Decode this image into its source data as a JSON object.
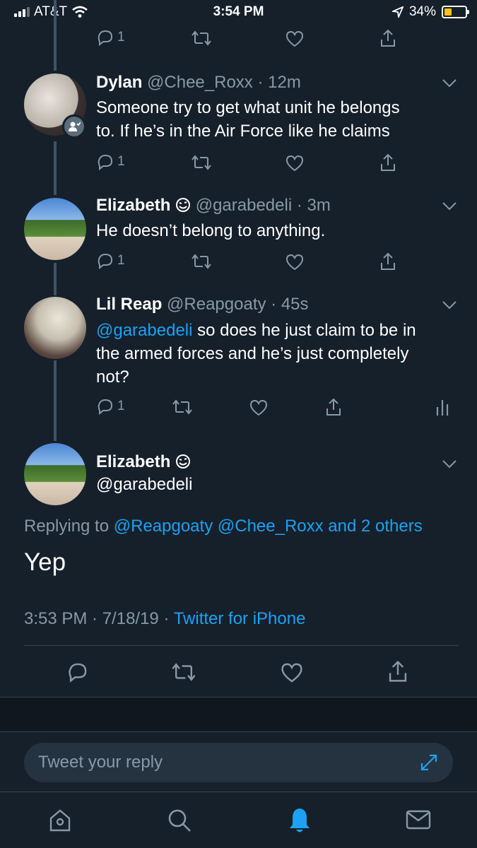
{
  "status_bar": {
    "carrier": "AT&T",
    "time": "3:54 PM",
    "battery": "34%"
  },
  "tweets": [
    {
      "reply_count": "1"
    },
    {
      "name": "Dylan",
      "handle": "@Chee_Roxx",
      "time": "· 12m",
      "text_lines": [
        "Someone try to get what unit he belongs",
        "to. If he’s in the Air Force like he claims"
      ],
      "reply_count": "1"
    },
    {
      "name": "Elizabeth",
      "handle": "@garabedeli",
      "time": "· 3m",
      "text": "He doesn’t belong to anything.",
      "reply_count": "1"
    },
    {
      "name": "Lil Reap",
      "handle": "@Reapgoaty",
      "time": "· 45s",
      "mention": "@garabedeli",
      "text_rest": " so does he just claim to be in",
      "text_lines": [
        "the armed forces and he’s just completely",
        "not?"
      ],
      "reply_count": "1"
    }
  ],
  "focused": {
    "name": "Elizabeth",
    "handle": "@garabedeli",
    "replying_prefix": "Replying to ",
    "replying_links": "@Reapgoaty @Chee_Roxx and 2 others",
    "text": "Yep",
    "date": "3:53 PM · 7/18/19 · ",
    "source": "Twitter for iPhone"
  },
  "composer": {
    "placeholder": "Tweet your reply"
  },
  "icons": {
    "reply": "reply-icon",
    "retweet": "retweet-icon",
    "like": "heart-icon",
    "share": "share-icon",
    "analytics": "analytics-icon",
    "home": "home-icon",
    "search": "search-icon",
    "notifications": "bell-icon",
    "messages": "mail-icon",
    "expand": "expand-icon"
  },
  "colors": {
    "background": "#15202b",
    "accent": "#1da1f2",
    "muted": "#8899a6",
    "battery": "#f5c518"
  }
}
